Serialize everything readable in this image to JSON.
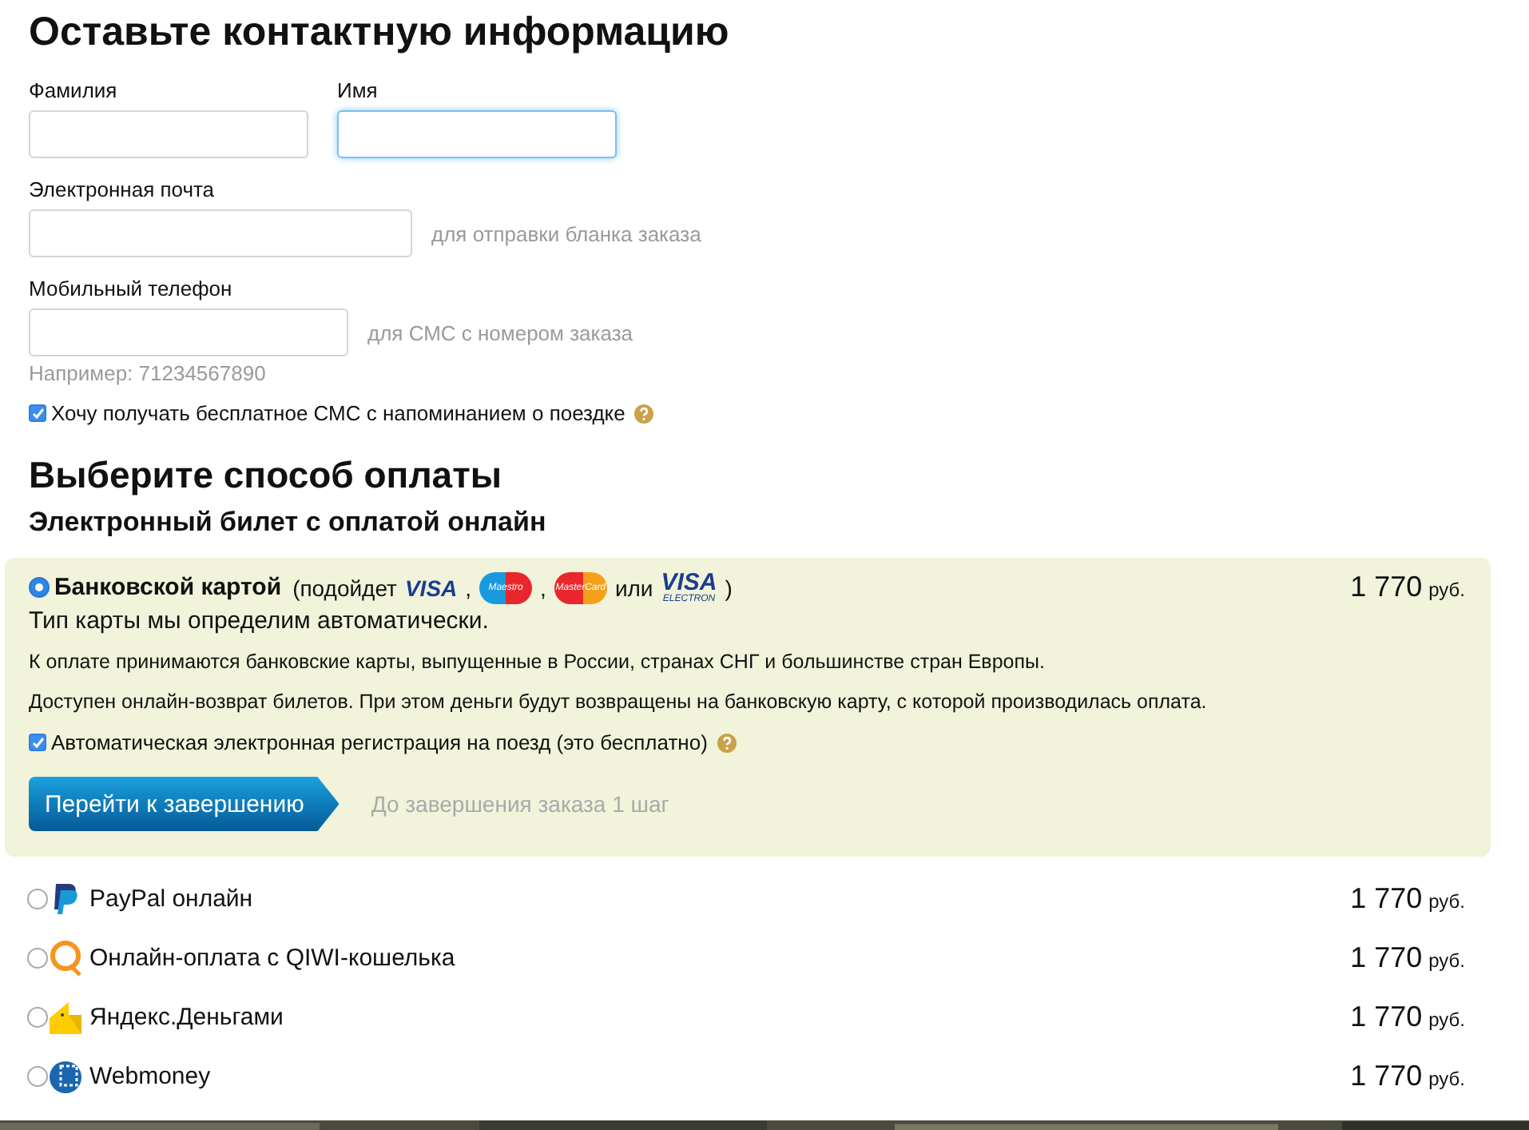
{
  "contact": {
    "title": "Оставьте контактную информацию",
    "name_fields": [
      {
        "label": "Фамилия",
        "focused": false
      },
      {
        "label": "Имя",
        "focused": true
      }
    ],
    "email": {
      "label": "Электронная почта",
      "note": "для отправки бланка заказа"
    },
    "phone": {
      "label": "Мобильный телефон",
      "note": "для СМС с номером заказа",
      "example": "Например: 71234567890"
    },
    "sms_reminder": {
      "label": "Хочу получать бесплатное СМС с напоминанием о поездке",
      "checked": true
    }
  },
  "payment": {
    "title": "Выберите способ оплаты",
    "subtitle": "Электронный билет с оплатой онлайн",
    "methods": [
      {
        "kind": "card",
        "label": "Банковской картой",
        "selected": true,
        "price": "1 770",
        "currency": "руб.",
        "card_parts": [
          {
            "kind": "text",
            "text": "(подойдет"
          },
          {
            "kind": "visa",
            "text": "VISA"
          },
          {
            "kind": "text",
            "text": ","
          },
          {
            "kind": "maestro",
            "text": "Maestro"
          },
          {
            "kind": "text",
            "text": ","
          },
          {
            "kind": "mastercard",
            "text": "MasterCard"
          },
          {
            "kind": "text",
            "text": "или"
          },
          {
            "kind": "visa-electron",
            "text": "VISA",
            "sub": "ELECTRON"
          },
          {
            "kind": "text",
            "text": ")"
          }
        ],
        "detail": "Тип карты мы определим автоматически.",
        "notes": [
          "К оплате принимаются банковские карты, выпущенные в России, странах СНГ и большинстве стран Европы.",
          "Доступен онлайн-возврат билетов. При этом деньги будут возвращены на банковскую карту, с которой производилась оплата."
        ],
        "registration": {
          "label": "Автоматическая электронная регистрация на поезд (это бесплатно)",
          "checked": true
        },
        "button": "Перейти к завершению",
        "step_note": "До завершения заказа 1 шаг"
      },
      {
        "kind": "paypal",
        "label": "PayPal онлайн",
        "selected": false,
        "price": "1 770",
        "currency": "руб."
      },
      {
        "kind": "qiwi",
        "label": "Онлайн-оплата с QIWI-кошелька",
        "selected": false,
        "price": "1 770",
        "currency": "руб."
      },
      {
        "kind": "yandex",
        "label": "Яндекс.Деньгами",
        "selected": false,
        "price": "1 770",
        "currency": "руб."
      },
      {
        "kind": "webmoney",
        "label": "Webmoney",
        "selected": false,
        "price": "1 770",
        "currency": "руб."
      }
    ]
  }
}
